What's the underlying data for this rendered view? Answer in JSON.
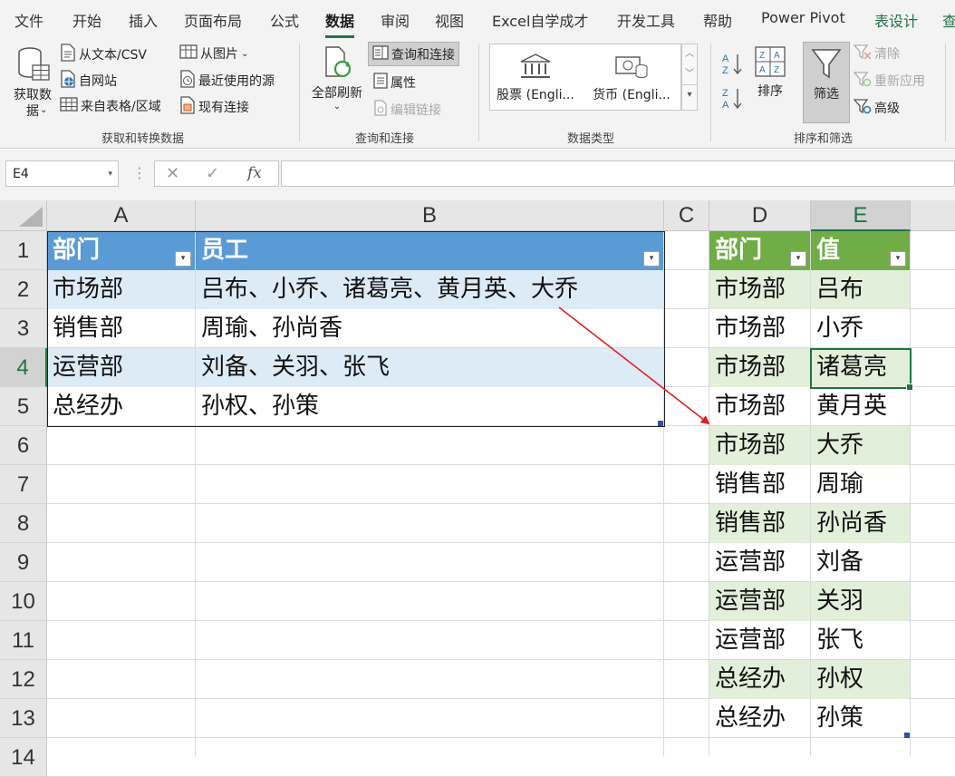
{
  "menu": {
    "tabs": [
      "文件",
      "开始",
      "插入",
      "页面布局",
      "公式",
      "数据",
      "审阅",
      "视图",
      "Excel自学成才",
      "开发工具",
      "帮助",
      "Power Pivot",
      "表设计",
      "查"
    ],
    "active": "数据"
  },
  "ribbon": {
    "get_transform": {
      "big_button": "获取数\n据",
      "from_text": "从文本/CSV",
      "from_web": "自网站",
      "from_table": "来自表格/区域",
      "from_picture": "从图片",
      "recent_sources": "最近使用的源",
      "existing_connections": "现有连接",
      "group_label": "获取和转换数据"
    },
    "queries": {
      "refresh_all": "全部刷新",
      "queries_connections": "查询和连接",
      "properties": "属性",
      "edit_links": "编辑链接",
      "group_label": "查询和连接"
    },
    "data_types": {
      "stocks": "股票 (Engli...",
      "currencies": "货币 (Engli...",
      "group_label": "数据类型"
    },
    "sort_filter": {
      "sort": "排序",
      "filter": "筛选",
      "clear": "清除",
      "reapply": "重新应用",
      "advanced": "高级",
      "group_label": "排序和筛选"
    }
  },
  "formula_bar": {
    "name_box": "E4",
    "cancel": "✕",
    "enter": "✓",
    "fx": "fx",
    "formula": ""
  },
  "grid": {
    "columns": [
      "A",
      "B",
      "C",
      "D",
      "E"
    ],
    "rows": [
      "1",
      "2",
      "3",
      "4",
      "5",
      "6",
      "7",
      "8",
      "9",
      "10",
      "11",
      "12",
      "13",
      "14"
    ],
    "selected_cell": "E4"
  },
  "table_left": {
    "headers": [
      "部门",
      "员工"
    ],
    "rows": [
      [
        "市场部",
        "吕布、小乔、诸葛亮、黄月英、大乔"
      ],
      [
        "销售部",
        "周瑜、孙尚香"
      ],
      [
        "运营部",
        "刘备、关羽、张飞"
      ],
      [
        "总经办",
        "孙权、孙策"
      ]
    ]
  },
  "table_right": {
    "headers": [
      "部门",
      "值"
    ],
    "rows": [
      [
        "市场部",
        "吕布"
      ],
      [
        "市场部",
        "小乔"
      ],
      [
        "市场部",
        "诸葛亮"
      ],
      [
        "市场部",
        "黄月英"
      ],
      [
        "市场部",
        "大乔"
      ],
      [
        "销售部",
        "周瑜"
      ],
      [
        "销售部",
        "孙尚香"
      ],
      [
        "运营部",
        "刘备"
      ],
      [
        "运营部",
        "关羽"
      ],
      [
        "运营部",
        "张飞"
      ],
      [
        "总经办",
        "孙权"
      ],
      [
        "总经办",
        "孙策"
      ]
    ]
  },
  "colors": {
    "accent": "#217346",
    "left_header": "#5b9bd5",
    "left_band": "#ddebf7",
    "right_header": "#70ad47",
    "right_band": "#e2efda",
    "arrow": "#e02020"
  }
}
